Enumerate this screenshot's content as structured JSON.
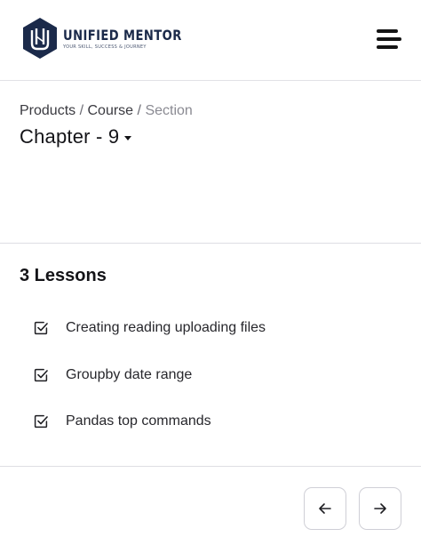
{
  "brand": {
    "name": "UNIFIED MENTOR",
    "tagline": "YOUR SKILL, SUCCESS & JOURNEY",
    "colors": {
      "primary": "#1b2a4a",
      "text": "#141418",
      "muted": "#8a8a92",
      "border": "#dedee3"
    }
  },
  "header": {
    "menu_icon": "hamburger-menu-icon"
  },
  "breadcrumb": {
    "items": [
      "Products",
      "Course"
    ],
    "separator": "/",
    "current": "Section"
  },
  "chapter": {
    "title": "Chapter - 9",
    "icon": "caret-down-icon"
  },
  "lessons": {
    "heading": "3 Lessons",
    "items": [
      {
        "label": "Creating reading uploading files",
        "icon": "checkbox-checked-icon"
      },
      {
        "label": "Groupby date range",
        "icon": "checkbox-checked-icon"
      },
      {
        "label": "Pandas top commands",
        "icon": "checkbox-checked-icon"
      }
    ]
  },
  "pagination": {
    "prev_icon": "arrow-left-icon",
    "next_icon": "arrow-right-icon"
  }
}
